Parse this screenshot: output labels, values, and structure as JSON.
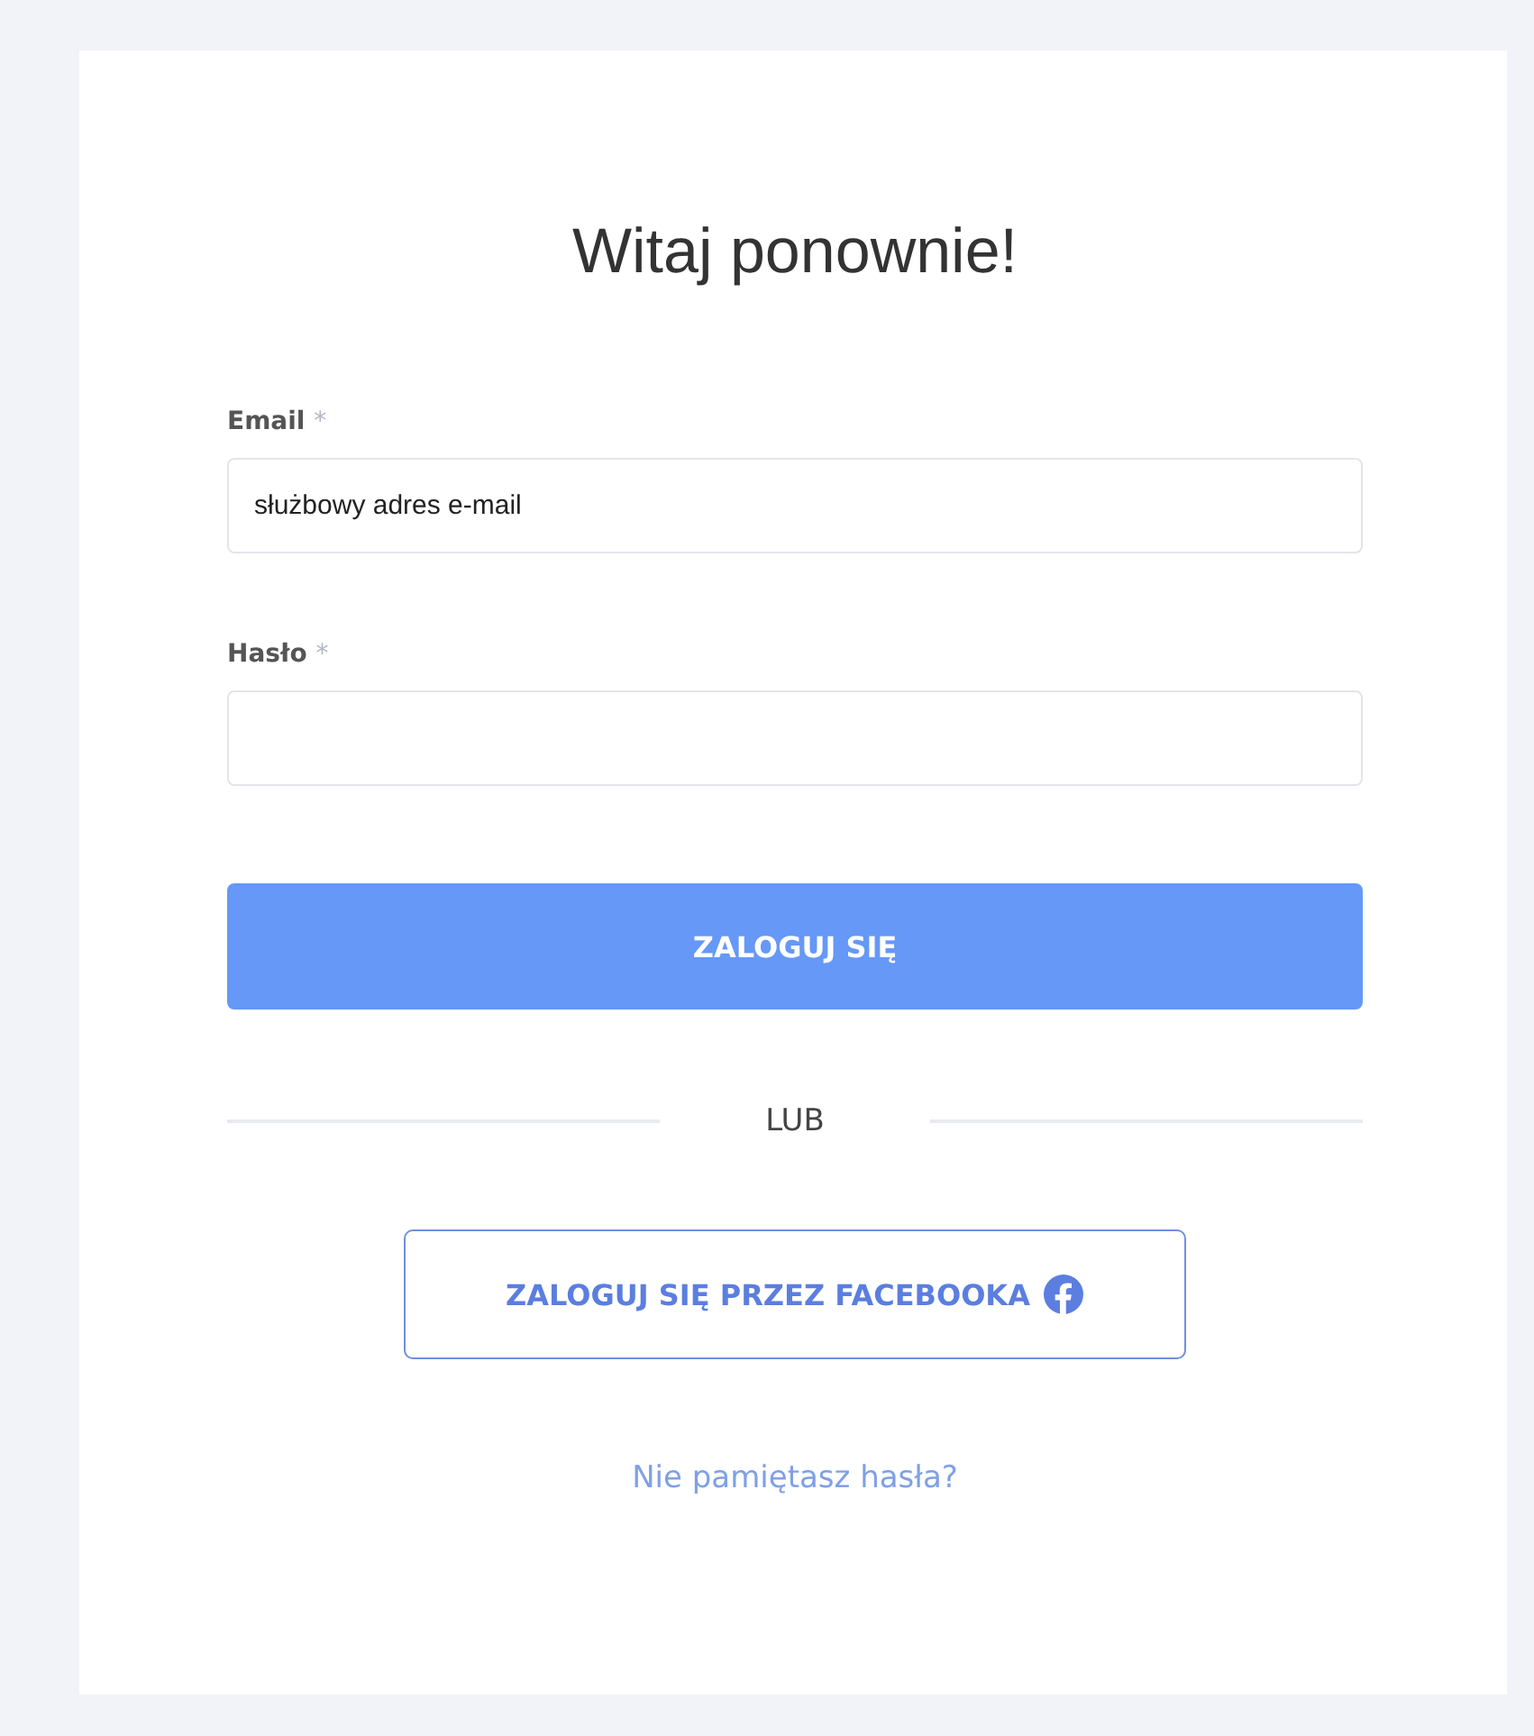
{
  "title": "Witaj ponownie!",
  "fields": [
    {
      "label": "Email",
      "required_mark": "*",
      "placeholder": "służbowy adres e-mail"
    },
    {
      "label": "Hasło",
      "required_mark": "*"
    }
  ],
  "login_button": "ZALOGUJ SIĘ",
  "divider_text": "LUB",
  "facebook_button": "ZALOGUJ SIĘ PRZEZ FACEBOOKA",
  "forgot_link": "Nie pamiętasz hasła?"
}
